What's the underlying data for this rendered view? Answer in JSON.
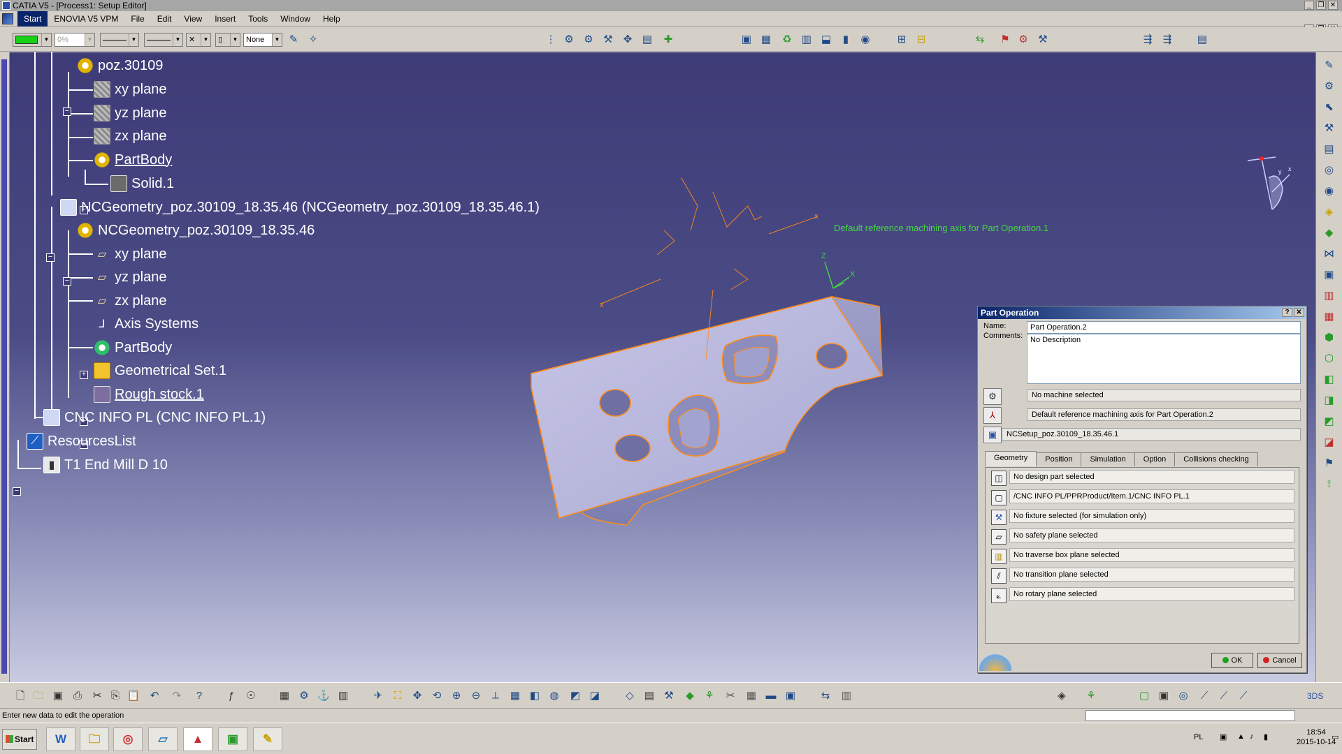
{
  "window": {
    "title": "CATIA V5 - [Process1: Setup Editor]"
  },
  "menu": [
    "Start",
    "ENOVIA V5 VPM",
    "File",
    "Edit",
    "View",
    "Insert",
    "Tools",
    "Window",
    "Help"
  ],
  "toolbar1": {
    "percent_value": "0%",
    "linetype_value": "None"
  },
  "tree": {
    "poz": "poz.30109",
    "xy1": "xy plane",
    "yz1": "yz plane",
    "zx1": "zx plane",
    "partbody1": "PartBody",
    "solid": "Solid.1",
    "ncgeom_product": "NCGeometry_poz.30109_18.35.46 (NCGeometry_poz.30109_18.35.46.1)",
    "ncgeom_part": "NCGeometry_poz.30109_18.35.46",
    "xy2": "xy plane",
    "yz2": "yz plane",
    "zx2": "zx plane",
    "axis_systems": "Axis Systems",
    "partbody2": "PartBody",
    "geoset": "Geometrical Set.1",
    "rough": "Rough stock.1",
    "cnc": "CNC INFO PL (CNC INFO PL.1)",
    "resources": "ResourcesList",
    "tool": "T1 End Mill D 10"
  },
  "viewport": {
    "axis_label": "Default reference machining axis for Part Operation.1"
  },
  "dialog": {
    "title": "Part Operation",
    "help_btn": "?",
    "close_btn": "✕",
    "name_label": "Name:",
    "name_value": "Part Operation.2",
    "comments_label": "Comments:",
    "comments_value": "No Description",
    "machine_value": "No machine selected",
    "axis_value": "Default reference machining axis for Part Operation.2",
    "setup_value": "NCSetup_poz.30109_18.35.46.1",
    "tabs": [
      "Geometry",
      "Position",
      "Simulation",
      "Option",
      "Collisions checking"
    ],
    "geometry_rows": [
      "No design part selected",
      "/CNC INFO PL/PPRProduct/Item.1/CNC INFO PL.1",
      "No fixture selected (for simulation only)",
      "No safety plane selected",
      "No traverse box plane selected",
      "No transition plane selected",
      "No rotary plane selected"
    ],
    "ok": "OK",
    "cancel": "Cancel"
  },
  "status": {
    "message": "Enter new data to edit the operation"
  },
  "taskbar": {
    "start": "Start",
    "word": "W",
    "lang": "PL",
    "time": "18:54",
    "date": "2015-10-14"
  },
  "colors": {
    "accent": "#ff8c1a",
    "viewport_top": "#3e3b77",
    "dialog_title": "#0a246a",
    "axis_green": "#46d646"
  }
}
